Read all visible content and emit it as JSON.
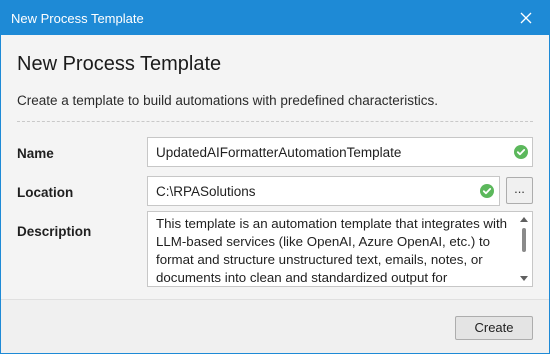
{
  "window": {
    "title": "New Process Template",
    "close_icon": "close-icon",
    "accent_color": "#1e8ad6"
  },
  "header": {
    "heading": "New Process Template",
    "subheading": "Create a template to build automations with predefined characteristics."
  },
  "form": {
    "name": {
      "label": "Name",
      "value": "UpdatedAIFormatterAutomationTemplate",
      "status_icon": "check-circle-icon",
      "status_color": "#5cb85c"
    },
    "location": {
      "label": "Location",
      "value": "C:\\RPASolutions",
      "status_icon": "check-circle-icon",
      "browse_label": "..."
    },
    "description": {
      "label": "Description",
      "value": "This template is an automation template that integrates with LLM-based services (like OpenAI, Azure OpenAI, etc.) to format and structure unstructured text, emails, notes, or documents into clean and standardized output for"
    }
  },
  "footer": {
    "create_label": "Create"
  }
}
